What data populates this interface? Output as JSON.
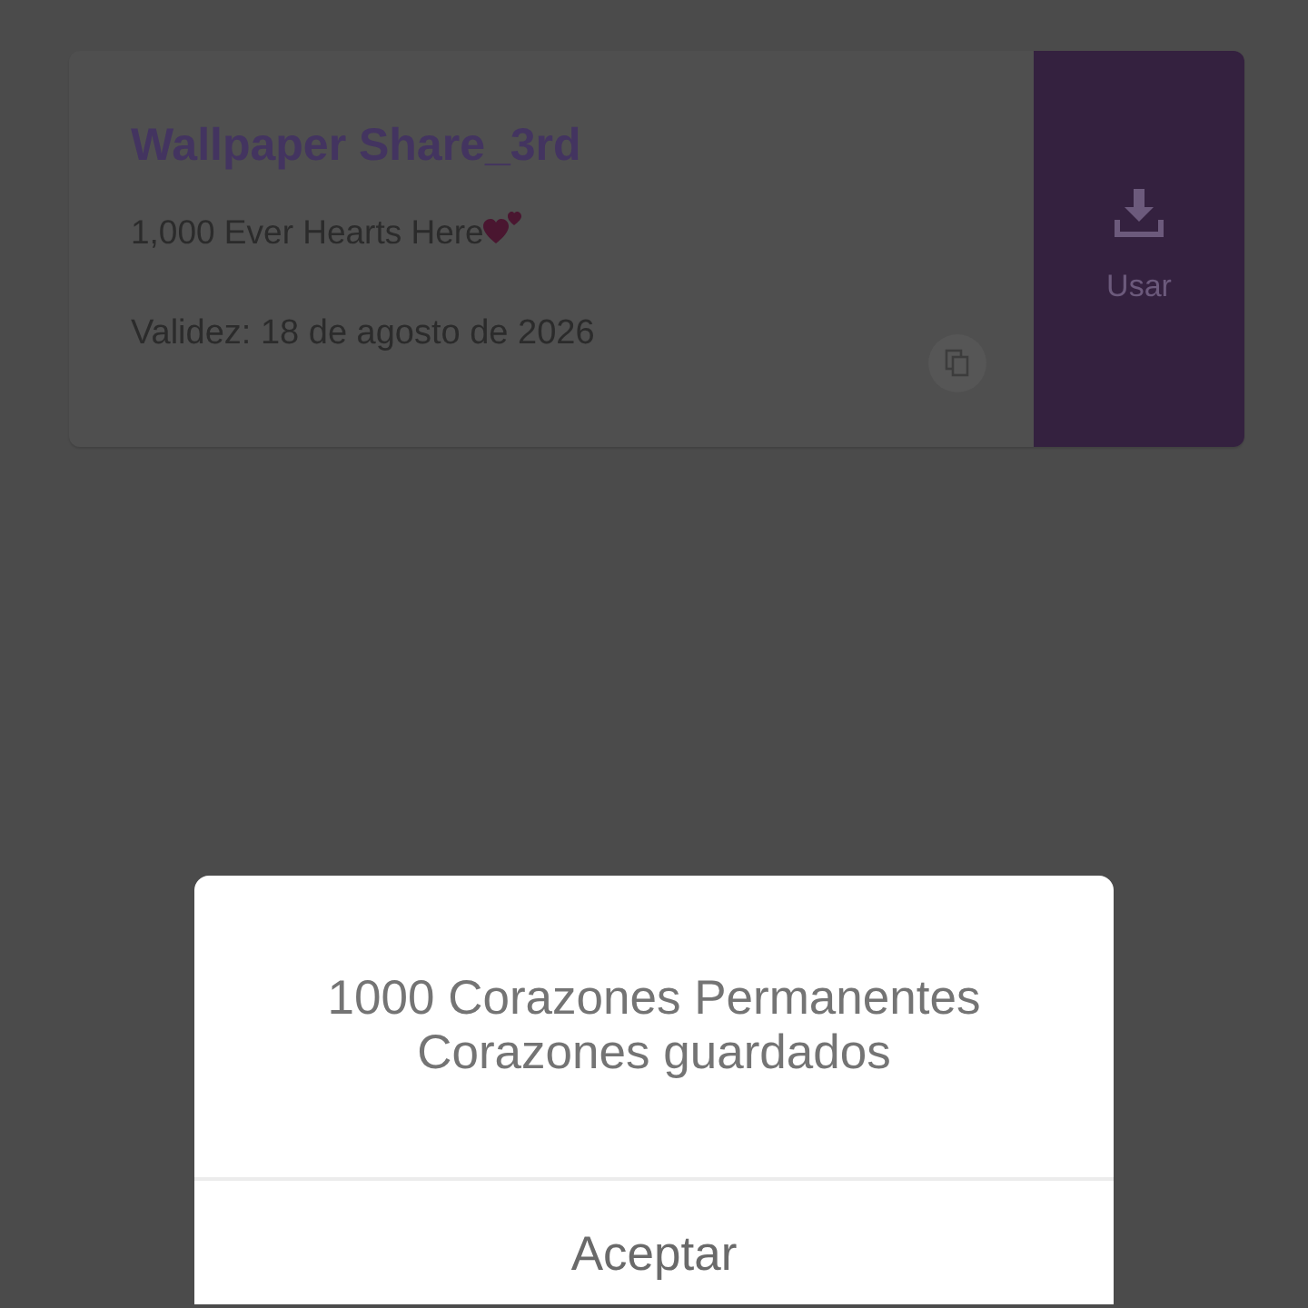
{
  "card": {
    "title": "Wallpaper Share_3rd",
    "description": "1,000 Ever Hearts Here",
    "validity": "Validez: 18 de agosto de 2026",
    "use_button": {
      "label": "Usar"
    }
  },
  "dialog": {
    "message_lines": [
      "1000 Corazones Permanentes",
      "Corazones guardados"
    ],
    "buttons": [
      "Aceptar"
    ]
  }
}
